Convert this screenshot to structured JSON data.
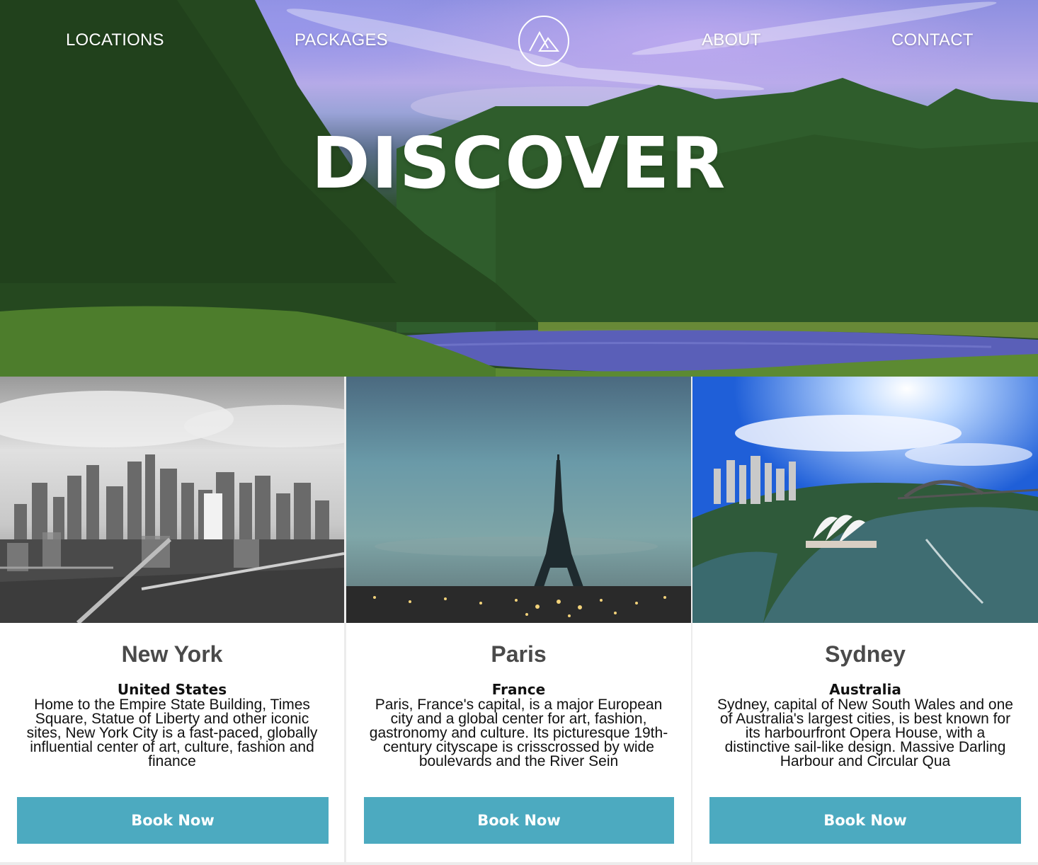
{
  "nav": {
    "items": [
      {
        "label": "LOCATIONS"
      },
      {
        "label": "PACKAGES"
      },
      {
        "label": "ABOUT"
      },
      {
        "label": "CONTACT"
      }
    ],
    "logo_icon": "mountain-logo-icon"
  },
  "hero": {
    "title": "DISCOVER"
  },
  "cards": [
    {
      "city": "New York",
      "country": "United States",
      "description": "Home to the Empire State Building, Times Square, Statue of Liberty and other iconic sites, New York City is a fast-paced, globally influential center of art, culture, fashion and finance",
      "button": "Book Now"
    },
    {
      "city": "Paris",
      "country": "France",
      "description": "Paris, France's capital, is a major European city and a global center for art, fashion, gastronomy and culture. Its picturesque 19th-century cityscape is crisscrossed by wide boulevards and the River Sein",
      "button": "Book Now"
    },
    {
      "city": "Sydney",
      "country": "Australia",
      "description": "Sydney, capital of New South Wales and one of Australia's largest cities, is best known for its harbourfront Opera House, with a distinctive sail-like design. Massive Darling Harbour and Circular Qua",
      "button": "Book Now"
    }
  ],
  "colors": {
    "button": "#4caac0",
    "city_text": "#4a4a4a",
    "card_bg": "#ffffff",
    "page_bg": "#ececec"
  }
}
